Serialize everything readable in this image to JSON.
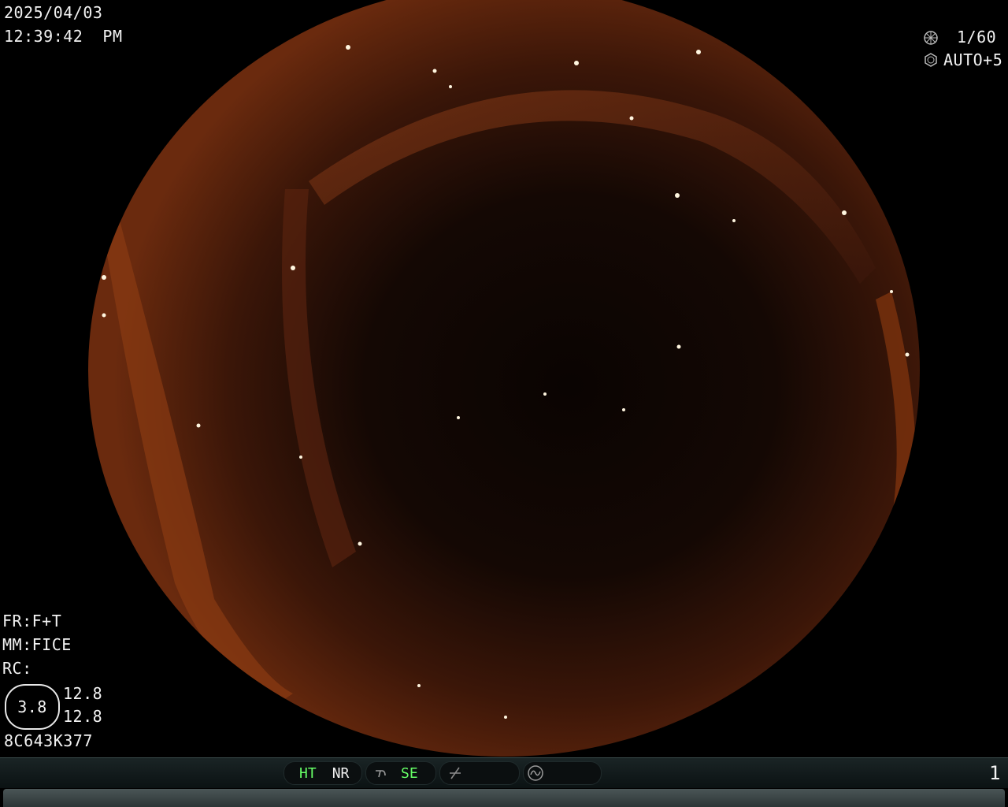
{
  "overlay": {
    "date": "2025/04/03",
    "time": "12:39:42  PM",
    "shutter": "1/60",
    "iris": "AUTO+5",
    "fr": "FR:F+T",
    "mm": "MM:FICE",
    "rc": "RC:",
    "zoom": "3.8",
    "value_a": "12.8",
    "value_b": "12.8",
    "serial": "8C643K377",
    "page_number": "1"
  },
  "status_bar": {
    "ht": "HT",
    "nr": "NR",
    "se": "SE"
  },
  "icons": [
    "shutter-icon",
    "iris-icon",
    "curve-icon",
    "slash-icon",
    "wave-icon"
  ]
}
